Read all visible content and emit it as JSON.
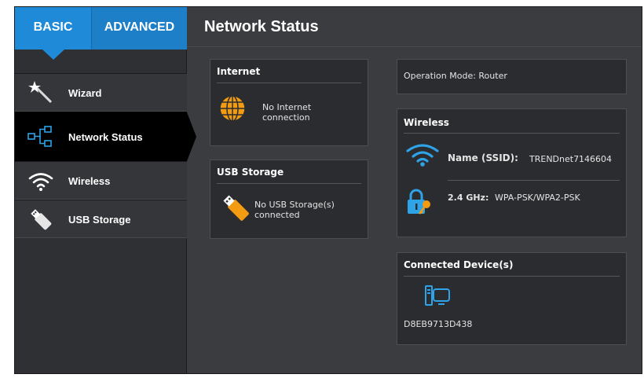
{
  "tabs": {
    "basic": "BASIC",
    "advanced": "ADVANCED"
  },
  "nav": {
    "wizard": "Wizard",
    "network_status": "Network Status",
    "wireless": "Wireless",
    "usb_storage": "USB Storage"
  },
  "main": {
    "title": "Network Status",
    "internet": {
      "title": "Internet",
      "status_line1": "No Internet",
      "status_line2": "connection"
    },
    "usb": {
      "title": "USB Storage",
      "status_line1": "No USB Storage(s)",
      "status_line2": "connected"
    },
    "operation_mode": "Operation Mode: Router",
    "wireless": {
      "title": "Wireless",
      "ssid_label": "Name (SSID):",
      "ssid_value": "TRENDnet7146604",
      "band_label": "2.4 GHz:",
      "band_value": "WPA-PSK/WPA2-PSK"
    },
    "devices": {
      "title": "Connected Device(s)",
      "device_name": "D8EB9713D438"
    }
  },
  "icons": {
    "wizard": "magic-wand-icon",
    "network": "network-tree-icon",
    "wireless": "wifi-icon",
    "usb": "usb-icon",
    "internet": "globe-icon",
    "lock": "lock-key-icon",
    "device": "computer-icon"
  },
  "colors": {
    "accent": "#1e8ad8",
    "globe": "#f39c12",
    "wifi": "#2ea3e8"
  }
}
